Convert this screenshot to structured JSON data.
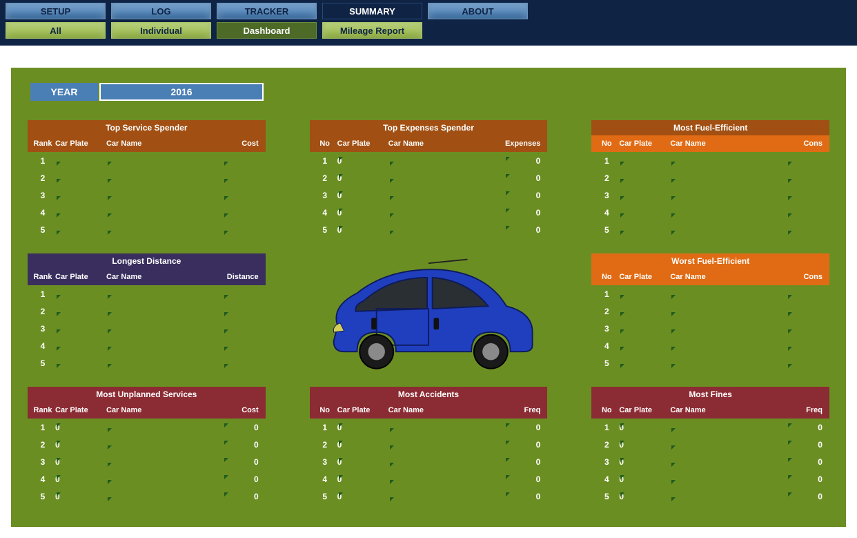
{
  "tabs": {
    "primary": [
      {
        "label": "SETUP",
        "style": "blue"
      },
      {
        "label": "LOG",
        "style": "blue"
      },
      {
        "label": "TRACKER",
        "style": "blue"
      },
      {
        "label": "SUMMARY",
        "style": "blue-dark"
      },
      {
        "label": "ABOUT",
        "style": "blue"
      }
    ],
    "secondary": [
      {
        "label": "All",
        "style": "green"
      },
      {
        "label": "Individual",
        "style": "green"
      },
      {
        "label": "Dashboard",
        "style": "green-dark"
      },
      {
        "label": "Mileage Report",
        "style": "green"
      }
    ]
  },
  "year": {
    "label": "YEAR",
    "value": "2016"
  },
  "panels": {
    "topServiceSpender": {
      "title": "Top Service Spender",
      "cols": [
        "Rank",
        "Car Plate",
        "Car Name",
        "Cost"
      ],
      "rows": [
        {
          "n": "1",
          "plate": "",
          "name": "",
          "val": ""
        },
        {
          "n": "2",
          "plate": "",
          "name": "",
          "val": ""
        },
        {
          "n": "3",
          "plate": "",
          "name": "",
          "val": ""
        },
        {
          "n": "4",
          "plate": "",
          "name": "",
          "val": ""
        },
        {
          "n": "5",
          "plate": "",
          "name": "",
          "val": ""
        }
      ]
    },
    "topExpensesSpender": {
      "title": "Top Expenses Spender",
      "cols": [
        "No",
        "Car Plate",
        "Car Name",
        "Expenses"
      ],
      "rows": [
        {
          "n": "1",
          "plate": "0",
          "name": "",
          "val": "0"
        },
        {
          "n": "2",
          "plate": "0",
          "name": "",
          "val": "0"
        },
        {
          "n": "3",
          "plate": "0",
          "name": "",
          "val": "0"
        },
        {
          "n": "4",
          "plate": "0",
          "name": "",
          "val": "0"
        },
        {
          "n": "5",
          "plate": "0",
          "name": "",
          "val": "0"
        }
      ]
    },
    "mostFuelEfficient": {
      "title": "Most Fuel-Efficient",
      "cols": [
        "No",
        "Car Plate",
        "Car Name",
        "Cons"
      ],
      "rows": [
        {
          "n": "1",
          "plate": "",
          "name": "",
          "val": ""
        },
        {
          "n": "2",
          "plate": "",
          "name": "",
          "val": ""
        },
        {
          "n": "3",
          "plate": "",
          "name": "",
          "val": ""
        },
        {
          "n": "4",
          "plate": "",
          "name": "",
          "val": ""
        },
        {
          "n": "5",
          "plate": "",
          "name": "",
          "val": ""
        }
      ]
    },
    "longestDistance": {
      "title": "Longest Distance",
      "cols": [
        "Rank",
        "Car Plate",
        "Car Name",
        "Distance"
      ],
      "rows": [
        {
          "n": "1",
          "plate": "",
          "name": "",
          "val": ""
        },
        {
          "n": "2",
          "plate": "",
          "name": "",
          "val": ""
        },
        {
          "n": "3",
          "plate": "",
          "name": "",
          "val": ""
        },
        {
          "n": "4",
          "plate": "",
          "name": "",
          "val": ""
        },
        {
          "n": "5",
          "plate": "",
          "name": "",
          "val": ""
        }
      ]
    },
    "worstFuelEfficient": {
      "title": "Worst Fuel-Efficient",
      "cols": [
        "No",
        "Car Plate",
        "Car Name",
        "Cons"
      ],
      "rows": [
        {
          "n": "1",
          "plate": "",
          "name": "",
          "val": ""
        },
        {
          "n": "2",
          "plate": "",
          "name": "",
          "val": ""
        },
        {
          "n": "3",
          "plate": "",
          "name": "",
          "val": ""
        },
        {
          "n": "4",
          "plate": "",
          "name": "",
          "val": ""
        },
        {
          "n": "5",
          "plate": "",
          "name": "",
          "val": ""
        }
      ]
    },
    "mostUnplannedServices": {
      "title": "Most Unplanned Services",
      "cols": [
        "Rank",
        "Car Plate",
        "Car Name",
        "Cost"
      ],
      "rows": [
        {
          "n": "1",
          "plate": "0",
          "name": "",
          "val": "0"
        },
        {
          "n": "2",
          "plate": "0",
          "name": "",
          "val": "0"
        },
        {
          "n": "3",
          "plate": "0",
          "name": "",
          "val": "0"
        },
        {
          "n": "4",
          "plate": "0",
          "name": "",
          "val": "0"
        },
        {
          "n": "5",
          "plate": "0",
          "name": "",
          "val": "0"
        }
      ]
    },
    "mostAccidents": {
      "title": "Most Accidents",
      "cols": [
        "No",
        "Car Plate",
        "Car Name",
        "Freq"
      ],
      "rows": [
        {
          "n": "1",
          "plate": "0",
          "name": "",
          "val": "0"
        },
        {
          "n": "2",
          "plate": "0",
          "name": "",
          "val": "0"
        },
        {
          "n": "3",
          "plate": "0",
          "name": "",
          "val": "0"
        },
        {
          "n": "4",
          "plate": "0",
          "name": "",
          "val": "0"
        },
        {
          "n": "5",
          "plate": "0",
          "name": "",
          "val": "0"
        }
      ]
    },
    "mostFines": {
      "title": "Most Fines",
      "cols": [
        "No",
        "Car Plate",
        "Car Name",
        "Freq"
      ],
      "rows": [
        {
          "n": "1",
          "plate": "0",
          "name": "",
          "val": "0"
        },
        {
          "n": "2",
          "plate": "0",
          "name": "",
          "val": "0"
        },
        {
          "n": "3",
          "plate": "0",
          "name": "",
          "val": "0"
        },
        {
          "n": "4",
          "plate": "0",
          "name": "",
          "val": "0"
        },
        {
          "n": "5",
          "plate": "0",
          "name": "",
          "val": "0"
        }
      ]
    }
  }
}
